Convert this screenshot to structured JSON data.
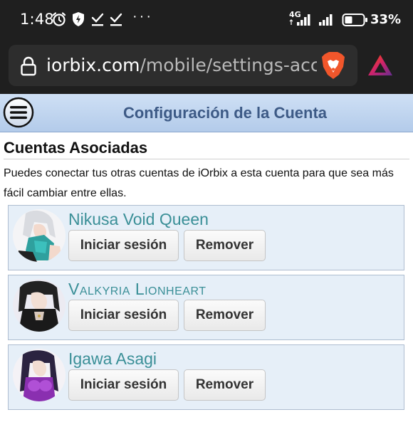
{
  "status_bar": {
    "time": "1:48",
    "dots": "···",
    "network": "4G",
    "battery_percent": "33%",
    "icons": [
      "alarm-icon",
      "shield-bolt-icon",
      "check-icon",
      "check-icon",
      "signal-icon",
      "signal-icon",
      "battery-icon"
    ]
  },
  "browser": {
    "domain": "iorbix.com",
    "path": "/mobile/settings-accoun",
    "icons": [
      "lock-icon",
      "brave-lion-icon",
      "brave-rewards-icon"
    ]
  },
  "header": {
    "title": "Configuración de la Cuenta",
    "colors": {
      "gradient_top": "#cfe0f5",
      "gradient_bottom": "#b3cbea",
      "title": "#3d5a86"
    }
  },
  "section": {
    "title": "Cuentas Asociadas",
    "description": "Puedes conectar tus otras cuentas de iOrbix a esta cuenta para que sea más fácil cambiar entre ellas."
  },
  "accounts": [
    {
      "name": "Nikusa Void Queen",
      "login_label": "Iniciar sesión",
      "remove_label": "Remover"
    },
    {
      "name": "Valkyria Lionheart",
      "login_label": "Iniciar sesión",
      "remove_label": "Remover"
    },
    {
      "name": "Igawa Asagi",
      "login_label": "Iniciar sesión",
      "remove_label": "Remover"
    }
  ],
  "colors": {
    "account_bg": "#e6eff8",
    "account_name": "#3a8f97",
    "statusbar_bg": "#1f1f1f"
  }
}
